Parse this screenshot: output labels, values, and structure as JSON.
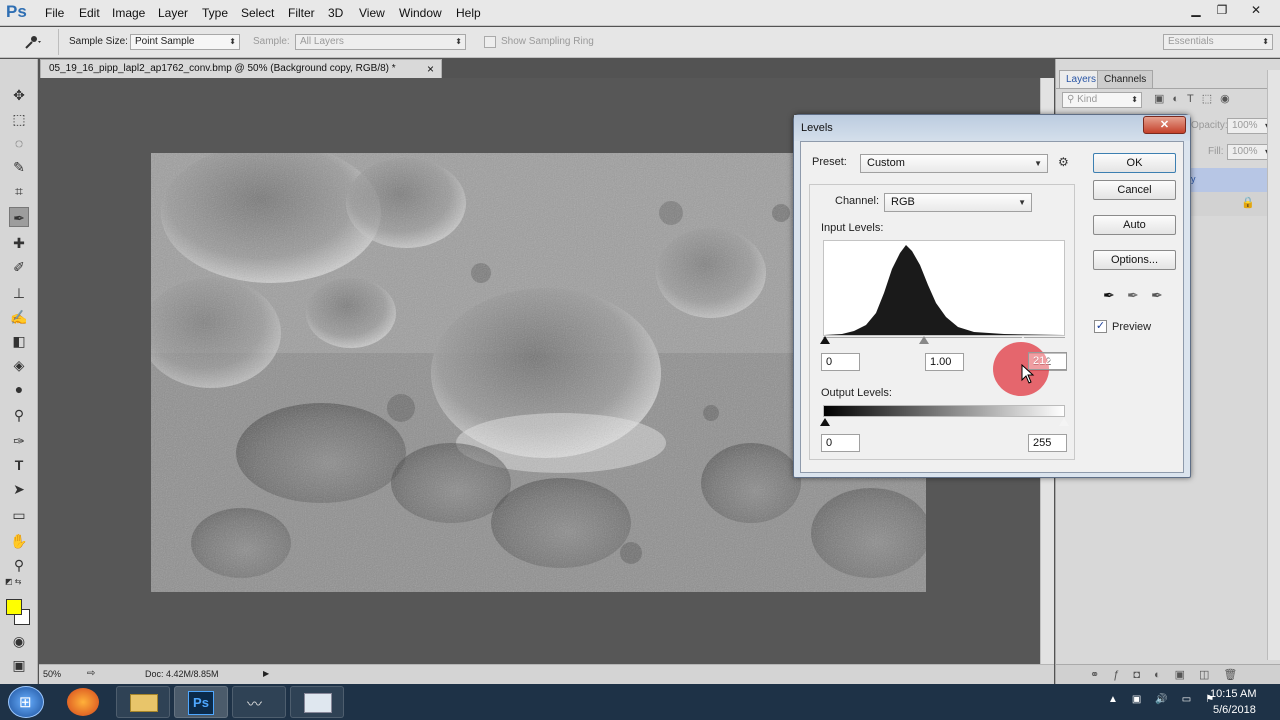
{
  "app": {
    "logo": "Ps"
  },
  "menu": [
    "File",
    "Edit",
    "Image",
    "Layer",
    "Type",
    "Select",
    "Filter",
    "3D",
    "View",
    "Window",
    "Help"
  ],
  "window_controls": {
    "minimize": "▁",
    "restore": "❐",
    "close": "✕"
  },
  "options": {
    "sample_size_label": "Sample Size:",
    "sample_size_value": "Point Sample",
    "sample_label": "Sample:",
    "sample_value": "All Layers",
    "show_ring_label": "Show Sampling Ring",
    "workspace": "Essentials"
  },
  "document": {
    "tab_title": "05_19_16_pipp_lapl2_ap1762_conv.bmp @ 50% (Background copy, RGB/8) *",
    "tab_close": "×",
    "zoom": "50%",
    "doc_info": "Doc: 4.42M/8.85M"
  },
  "panels": {
    "tabs": [
      "Layers",
      "Channels"
    ],
    "filter_kind": "Kind",
    "opacity_label": "Opacity:",
    "opacity_value": "100%",
    "fill_label": "Fill:",
    "fill_value": "100%",
    "layer_partial": "py"
  },
  "dialog": {
    "title": "Levels",
    "close": "✕",
    "preset_label": "Preset:",
    "preset_value": "Custom",
    "channel_label": "Channel:",
    "channel_value": "RGB",
    "input_levels_label": "Input Levels:",
    "input_black": "0",
    "input_gamma": "1.00",
    "input_white": "212",
    "output_levels_label": "Output Levels:",
    "output_black": "0",
    "output_white": "255",
    "buttons": {
      "ok": "OK",
      "cancel": "Cancel",
      "auto": "Auto",
      "options": "Options..."
    },
    "preview_label": "Preview",
    "preview_checked": true
  },
  "taskbar": {
    "ps_label": "Ps",
    "time": "10:15 AM",
    "date": "5/6/2018"
  },
  "colors": {
    "accent": "#2f6fb3",
    "foreground_swatch": "#ffff00",
    "background_swatch": "#ffffff",
    "click_marker": "#e0303a"
  }
}
